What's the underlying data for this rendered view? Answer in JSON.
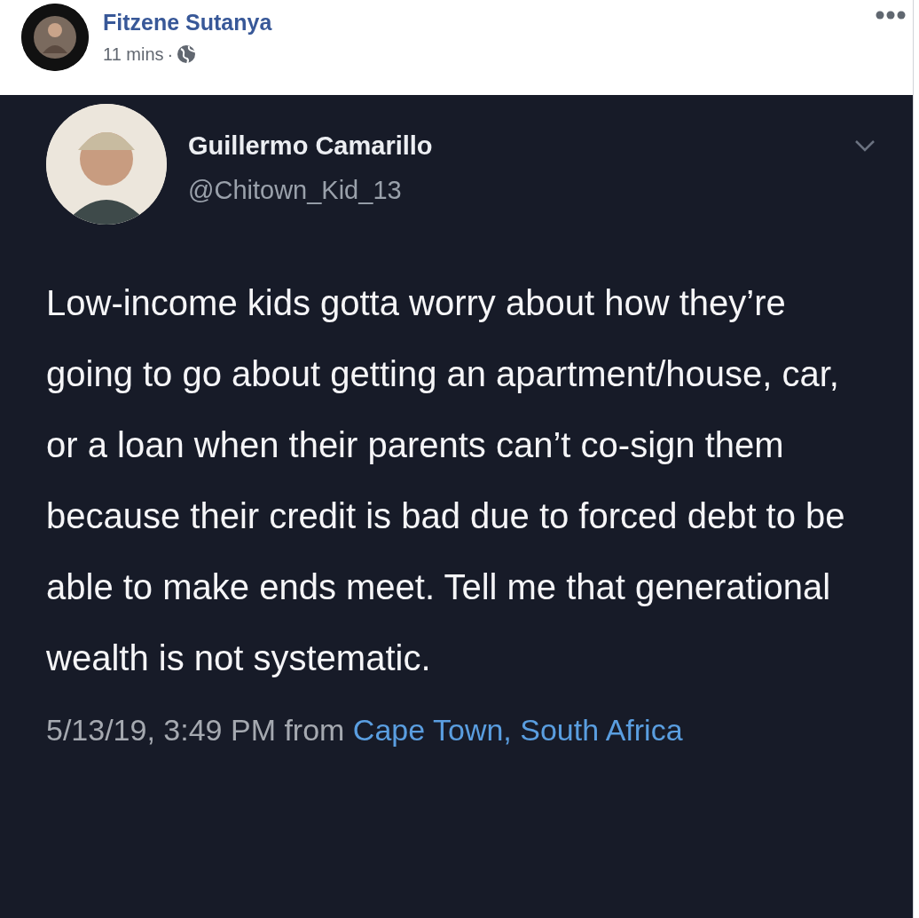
{
  "post": {
    "author": "Fitzene Sutanya",
    "time": "11 mins",
    "separator": "·"
  },
  "tweet": {
    "name": "Guillermo Camarillo",
    "handle": "@Chitown_Kid_13",
    "text": "Low-income kids gotta worry about how they’re going to go about getting an apartment/house, car, or a loan when their parents can’t co-sign them because their credit is bad due to forced debt to be able to make ends meet. Tell me that generational wealth is not systematic.",
    "timestamp": "5/13/19, 3:49 PM from",
    "location": "Cape Town, South Africa"
  }
}
